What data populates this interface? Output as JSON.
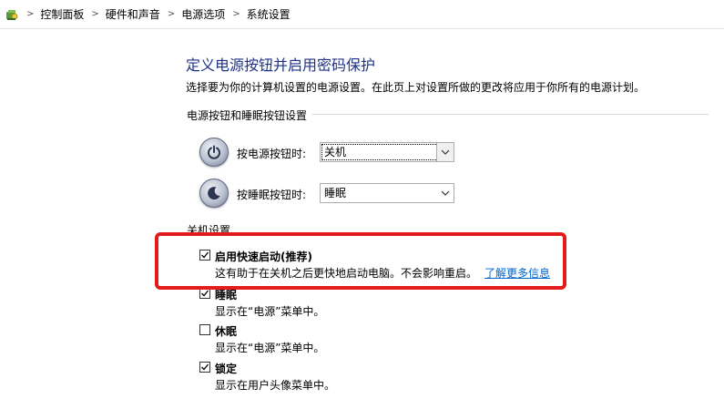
{
  "address_bar": {
    "icon": "control-panel-icon",
    "breadcrumbs": [
      {
        "label": "控制面板"
      },
      {
        "label": "硬件和声音"
      },
      {
        "label": "电源选项"
      },
      {
        "label": "系统设置"
      }
    ]
  },
  "page": {
    "title": "定义电源按钮并启用密码保护",
    "description": "选择要为你的计算机设置的电源设置。在此页上对设置所做的更改将应用于你所有的电源计划。"
  },
  "power_buttons": {
    "group_label": "电源按钮和睡眠按钮设置",
    "power_button": {
      "icon": "power-button-icon",
      "label": "按电源按钮时:",
      "value": "关机"
    },
    "sleep_button": {
      "icon": "sleep-button-icon",
      "label": "按睡眠按钮时:",
      "value": "睡眠"
    }
  },
  "shutdown_settings": {
    "group_label": "关机设置",
    "items": [
      {
        "name": "启用快速启动(推荐)",
        "checked": true,
        "description": "这有助于在关机之后更快地启动电脑。不会影响重启。",
        "link": "了解更多信息"
      },
      {
        "name": "睡眠",
        "checked": true,
        "description": "显示在“电源”菜单中。"
      },
      {
        "name": "休眠",
        "checked": false,
        "description": "显示在“电源”菜单中。"
      },
      {
        "name": "锁定",
        "checked": true,
        "description": "显示在用户头像菜单中。"
      }
    ]
  },
  "colors": {
    "title": "#1e3287",
    "link": "#0066cc",
    "highlight": "#e31b1b"
  }
}
